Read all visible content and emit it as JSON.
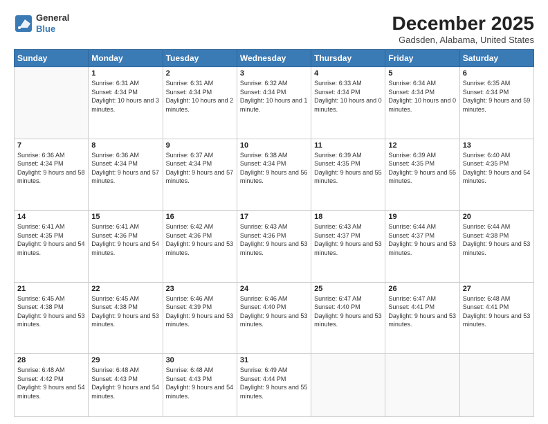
{
  "header": {
    "logo_line1": "General",
    "logo_line2": "Blue",
    "month": "December 2025",
    "location": "Gadsden, Alabama, United States"
  },
  "weekdays": [
    "Sunday",
    "Monday",
    "Tuesday",
    "Wednesday",
    "Thursday",
    "Friday",
    "Saturday"
  ],
  "weeks": [
    [
      {
        "num": "",
        "empty": true
      },
      {
        "num": "1",
        "sunrise": "6:31 AM",
        "sunset": "4:34 PM",
        "daylight": "10 hours and 3 minutes."
      },
      {
        "num": "2",
        "sunrise": "6:31 AM",
        "sunset": "4:34 PM",
        "daylight": "10 hours and 2 minutes."
      },
      {
        "num": "3",
        "sunrise": "6:32 AM",
        "sunset": "4:34 PM",
        "daylight": "10 hours and 1 minute."
      },
      {
        "num": "4",
        "sunrise": "6:33 AM",
        "sunset": "4:34 PM",
        "daylight": "10 hours and 0 minutes."
      },
      {
        "num": "5",
        "sunrise": "6:34 AM",
        "sunset": "4:34 PM",
        "daylight": "10 hours and 0 minutes."
      },
      {
        "num": "6",
        "sunrise": "6:35 AM",
        "sunset": "4:34 PM",
        "daylight": "9 hours and 59 minutes."
      }
    ],
    [
      {
        "num": "7",
        "sunrise": "6:36 AM",
        "sunset": "4:34 PM",
        "daylight": "9 hours and 58 minutes."
      },
      {
        "num": "8",
        "sunrise": "6:36 AM",
        "sunset": "4:34 PM",
        "daylight": "9 hours and 57 minutes."
      },
      {
        "num": "9",
        "sunrise": "6:37 AM",
        "sunset": "4:34 PM",
        "daylight": "9 hours and 57 minutes."
      },
      {
        "num": "10",
        "sunrise": "6:38 AM",
        "sunset": "4:34 PM",
        "daylight": "9 hours and 56 minutes."
      },
      {
        "num": "11",
        "sunrise": "6:39 AM",
        "sunset": "4:35 PM",
        "daylight": "9 hours and 55 minutes."
      },
      {
        "num": "12",
        "sunrise": "6:39 AM",
        "sunset": "4:35 PM",
        "daylight": "9 hours and 55 minutes."
      },
      {
        "num": "13",
        "sunrise": "6:40 AM",
        "sunset": "4:35 PM",
        "daylight": "9 hours and 54 minutes."
      }
    ],
    [
      {
        "num": "14",
        "sunrise": "6:41 AM",
        "sunset": "4:35 PM",
        "daylight": "9 hours and 54 minutes."
      },
      {
        "num": "15",
        "sunrise": "6:41 AM",
        "sunset": "4:36 PM",
        "daylight": "9 hours and 54 minutes."
      },
      {
        "num": "16",
        "sunrise": "6:42 AM",
        "sunset": "4:36 PM",
        "daylight": "9 hours and 53 minutes."
      },
      {
        "num": "17",
        "sunrise": "6:43 AM",
        "sunset": "4:36 PM",
        "daylight": "9 hours and 53 minutes."
      },
      {
        "num": "18",
        "sunrise": "6:43 AM",
        "sunset": "4:37 PM",
        "daylight": "9 hours and 53 minutes."
      },
      {
        "num": "19",
        "sunrise": "6:44 AM",
        "sunset": "4:37 PM",
        "daylight": "9 hours and 53 minutes."
      },
      {
        "num": "20",
        "sunrise": "6:44 AM",
        "sunset": "4:38 PM",
        "daylight": "9 hours and 53 minutes."
      }
    ],
    [
      {
        "num": "21",
        "sunrise": "6:45 AM",
        "sunset": "4:38 PM",
        "daylight": "9 hours and 53 minutes."
      },
      {
        "num": "22",
        "sunrise": "6:45 AM",
        "sunset": "4:38 PM",
        "daylight": "9 hours and 53 minutes."
      },
      {
        "num": "23",
        "sunrise": "6:46 AM",
        "sunset": "4:39 PM",
        "daylight": "9 hours and 53 minutes."
      },
      {
        "num": "24",
        "sunrise": "6:46 AM",
        "sunset": "4:40 PM",
        "daylight": "9 hours and 53 minutes."
      },
      {
        "num": "25",
        "sunrise": "6:47 AM",
        "sunset": "4:40 PM",
        "daylight": "9 hours and 53 minutes."
      },
      {
        "num": "26",
        "sunrise": "6:47 AM",
        "sunset": "4:41 PM",
        "daylight": "9 hours and 53 minutes."
      },
      {
        "num": "27",
        "sunrise": "6:48 AM",
        "sunset": "4:41 PM",
        "daylight": "9 hours and 53 minutes."
      }
    ],
    [
      {
        "num": "28",
        "sunrise": "6:48 AM",
        "sunset": "4:42 PM",
        "daylight": "9 hours and 54 minutes."
      },
      {
        "num": "29",
        "sunrise": "6:48 AM",
        "sunset": "4:43 PM",
        "daylight": "9 hours and 54 minutes."
      },
      {
        "num": "30",
        "sunrise": "6:48 AM",
        "sunset": "4:43 PM",
        "daylight": "9 hours and 54 minutes."
      },
      {
        "num": "31",
        "sunrise": "6:49 AM",
        "sunset": "4:44 PM",
        "daylight": "9 hours and 55 minutes."
      },
      {
        "num": "",
        "empty": true
      },
      {
        "num": "",
        "empty": true
      },
      {
        "num": "",
        "empty": true
      }
    ]
  ]
}
